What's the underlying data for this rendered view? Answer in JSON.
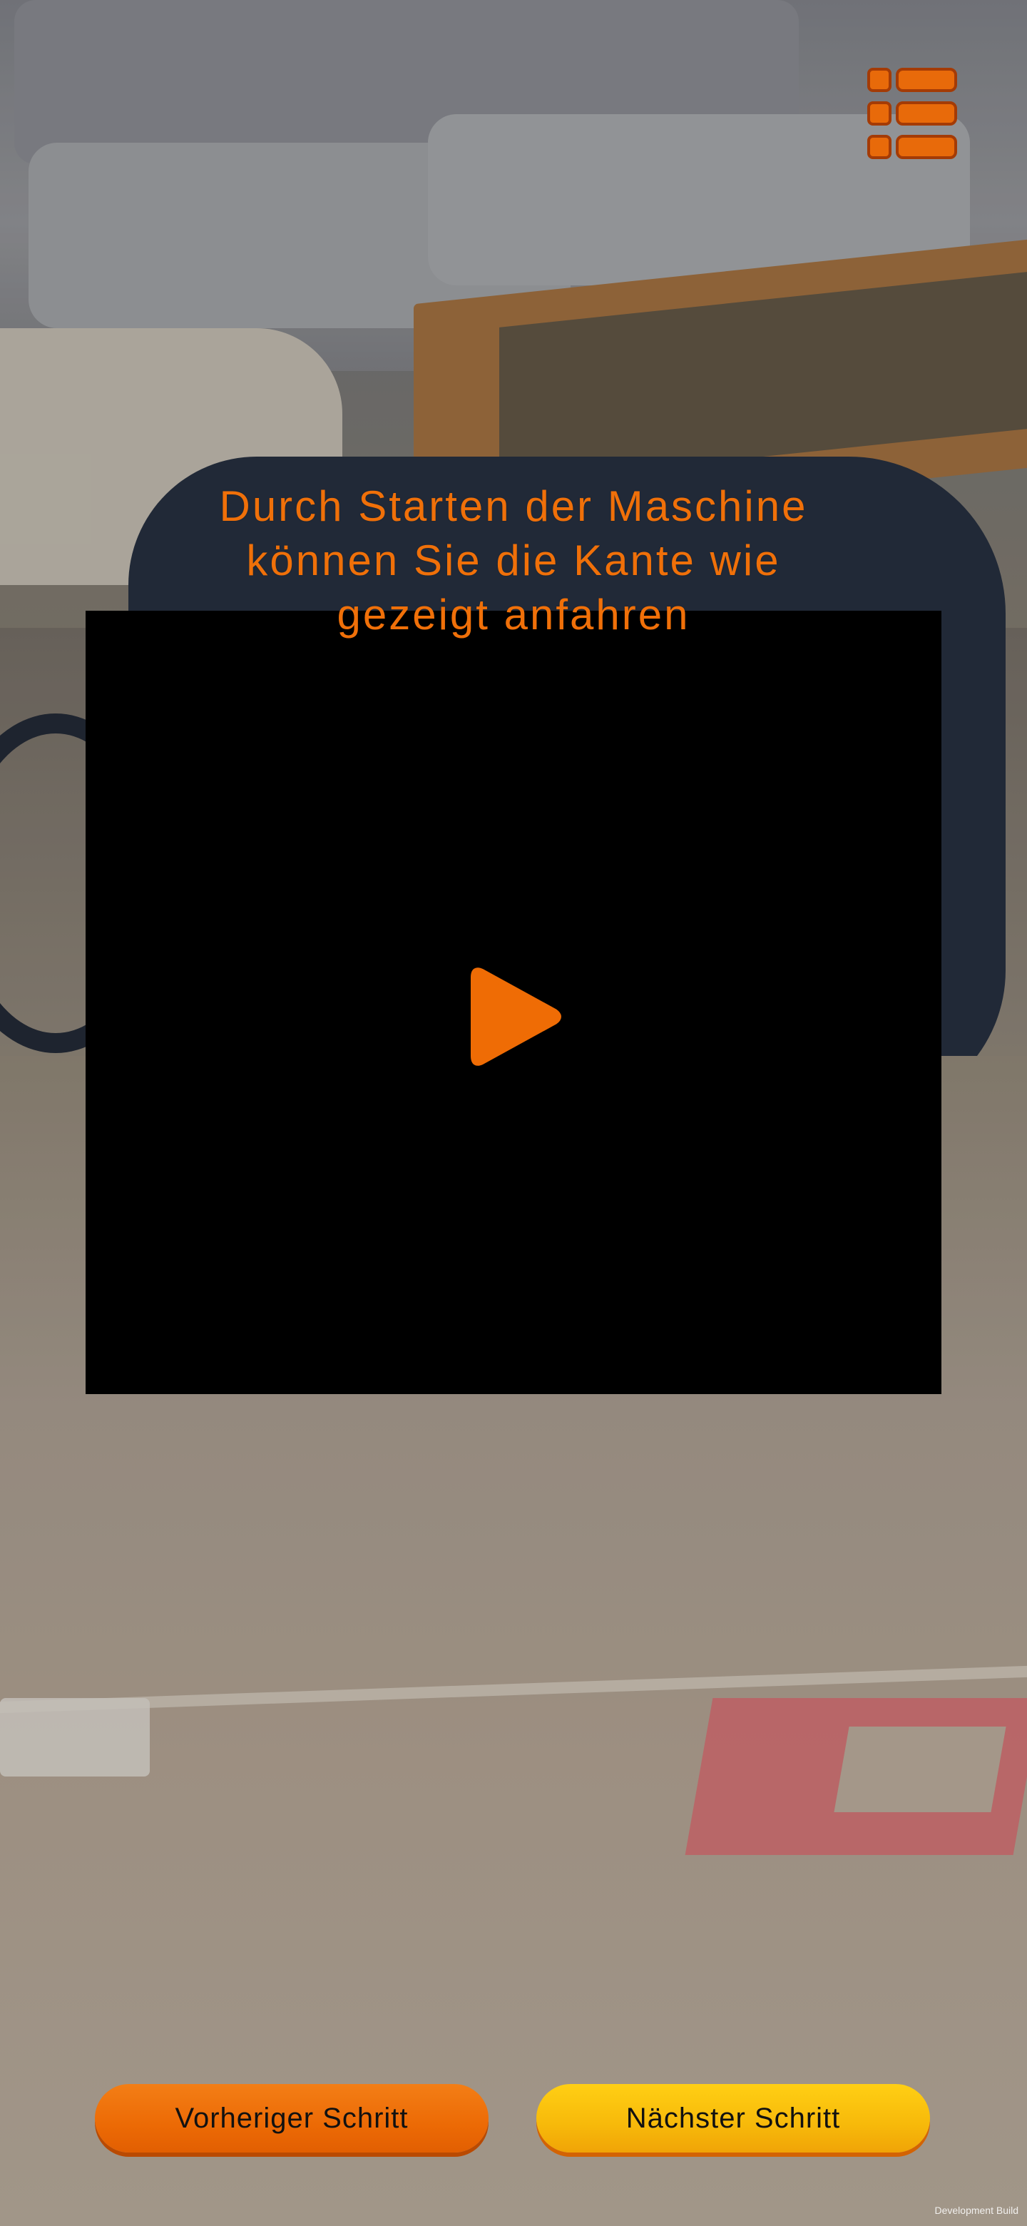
{
  "instruction": {
    "line1": "Durch Starten der Maschine",
    "line2": "können Sie die Kante wie",
    "line3": "gezeigt anfahren"
  },
  "menu": {
    "icon": "list-menu-icon"
  },
  "video": {
    "play_icon": "play-icon"
  },
  "navigation": {
    "prev_label": "Vorheriger Schritt",
    "next_label": "Nächster Schritt"
  },
  "footer": {
    "build_label": "Development Build"
  },
  "colors": {
    "accent_orange": "#f07009",
    "accent_yellow": "#f7b90a",
    "video_background": "#000000"
  }
}
